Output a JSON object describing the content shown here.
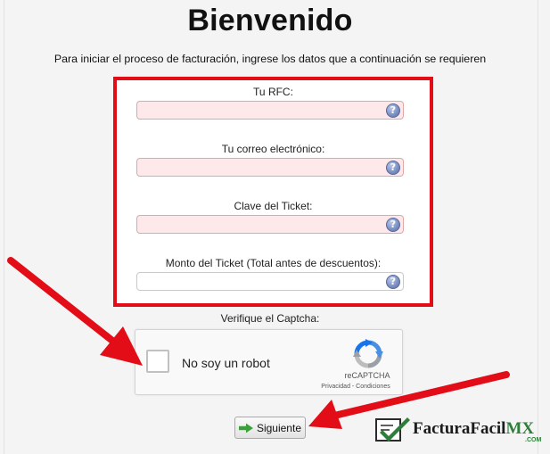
{
  "page": {
    "title": "Bienvenido",
    "subtitle": "Para iniciar el proceso de facturación, ingrese los datos que a continuación se requieren"
  },
  "form": {
    "fields": [
      {
        "label": "Tu RFC:",
        "value": "",
        "required": true
      },
      {
        "label": "Tu correo electrónico:",
        "value": "",
        "required": true
      },
      {
        "label": "Clave del Ticket:",
        "value": "",
        "required": true
      },
      {
        "label": "Monto del Ticket (Total antes de descuentos):",
        "value": "",
        "required": false
      }
    ],
    "help_icon": "question-mark-icon",
    "help_glyph": "?"
  },
  "captcha": {
    "label": "Verifique el Captcha:",
    "checkbox_text": "No soy un robot",
    "brand": "reCAPTCHA",
    "links": "Privacidad - Condiciones"
  },
  "actions": {
    "next_label": "Siguiente",
    "next_icon": "arrow-right-icon"
  },
  "logo": {
    "name_main": "FacturaFacil",
    "name_suffix": "MX",
    "domain": ".COM"
  },
  "colors": {
    "highlight_red": "#e30d18",
    "required_field_bg": "#fde8ea",
    "logo_green": "#2f7d3a"
  }
}
